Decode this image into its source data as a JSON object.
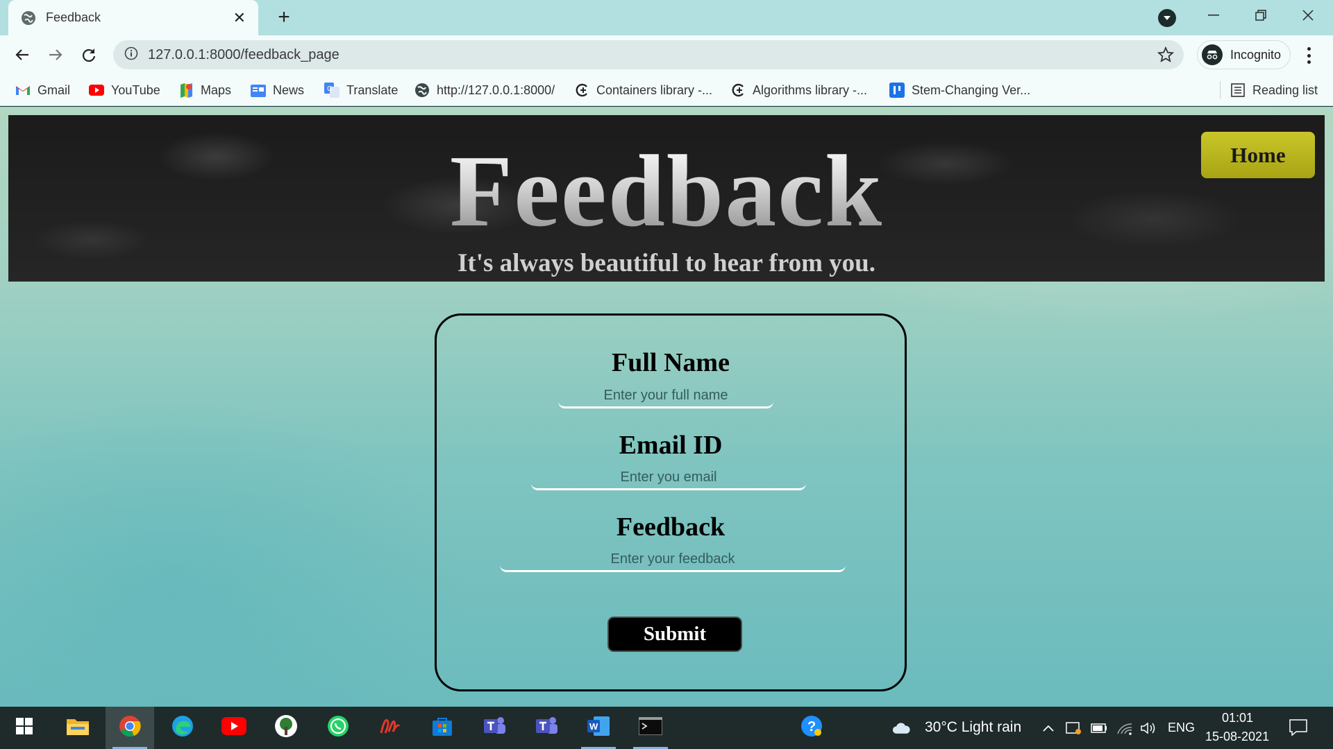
{
  "browser": {
    "tab_title": "Feedback",
    "url": "127.0.0.1:8000/feedback_page",
    "profile_label": "Incognito",
    "reading_list_label": "Reading list",
    "bookmarks": [
      {
        "label": "Gmail",
        "icon": "gmail-icon"
      },
      {
        "label": "YouTube",
        "icon": "youtube-icon"
      },
      {
        "label": "Maps",
        "icon": "maps-icon"
      },
      {
        "label": "News",
        "icon": "news-icon"
      },
      {
        "label": "Translate",
        "icon": "translate-icon"
      },
      {
        "label": "http://127.0.0.1:8000/",
        "icon": "globe-icon"
      },
      {
        "label": "Containers library -...",
        "icon": "cpp-icon"
      },
      {
        "label": "Algorithms library -...",
        "icon": "cpp-icon"
      },
      {
        "label": "Stem-Changing Ver...",
        "icon": "bookmark-app-icon"
      }
    ]
  },
  "page": {
    "title": "Feedback",
    "subtitle": "It's always beautiful to hear from you.",
    "home_label": "Home",
    "form": {
      "name_label": "Full Name",
      "name_placeholder": "Enter your full name",
      "email_label": "Email ID",
      "email_placeholder": "Enter you email",
      "feedback_label": "Feedback",
      "feedback_placeholder": "Enter your feedback",
      "submit_label": "Submit"
    }
  },
  "taskbar": {
    "apps": [
      "start",
      "file-explorer",
      "chrome",
      "edge",
      "youtube",
      "tree-app",
      "whatsapp",
      "acrobat-sign",
      "store",
      "teams",
      "teams-2",
      "word",
      "terminal",
      "help"
    ],
    "weather_text": "30°C  Light rain",
    "language": "ENG",
    "time": "01:01",
    "date": "15-08-2021"
  },
  "colors": {
    "accent_home": "#bdb91f",
    "tab_bg": "#b2dfe0",
    "page_teal": "#7fc4c0"
  }
}
